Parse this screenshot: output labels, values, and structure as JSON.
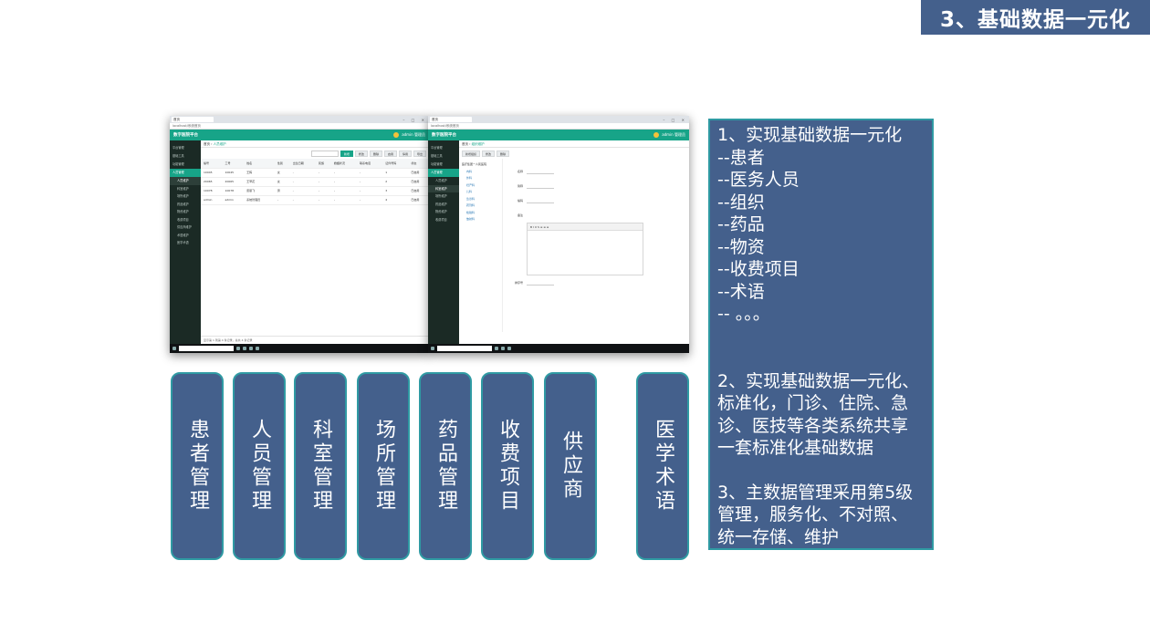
{
  "slide_title": "3、基础数据一元化",
  "screenshot_left": {
    "tab_label": "首页",
    "address": "localhost/系统首页",
    "app_logo": "数字医院平台",
    "user_name": "admin 管理员",
    "breadcrumb_home": "首页",
    "breadcrumb_current": "人员维护",
    "toolbar_buttons": [
      "新增",
      "修改",
      "删除",
      "启用",
      "停用",
      "导出"
    ],
    "sidebar_items": [
      "平台管理",
      "基础工具",
      "功能管理",
      "人员管理"
    ],
    "sidebar_subitems": [
      "人员维护",
      "科室维护",
      "场所维护",
      "药品维护",
      "物资维护",
      "收费项目",
      "供应商维护",
      "术语维护",
      "医学术语"
    ],
    "table_header": [
      "编号",
      "工号",
      "姓名",
      "性别",
      "出生日期",
      "民族",
      "婚姻状况",
      "联系电话",
      "证件号码",
      "状态"
    ],
    "table_rows": [
      [
        "1",
        "10045",
        "10045",
        "王辉",
        "女",
        "-",
        "-",
        "-",
        "-",
        "已启用"
      ],
      [
        "2",
        "20065",
        "20065",
        "王翠花",
        "女",
        "-",
        "-",
        "-",
        "-",
        "已启用"
      ],
      [
        "3",
        "10078",
        "10078",
        "唐丽飞",
        "男",
        "-",
        "-",
        "-",
        "-",
        "已启用"
      ],
      [
        "4",
        "admin",
        "admin",
        "系统管理员",
        "-",
        "-",
        "-",
        "-",
        "-",
        "已启用"
      ]
    ],
    "footer_text": "显示第 1 到第 4 条记录，总共 4 条记录"
  },
  "screenshot_right": {
    "tab_label": "首页",
    "address": "localhost/系统首页",
    "app_logo": "数字医院平台",
    "user_name": "admin 管理员",
    "breadcrumb_home": "首页",
    "breadcrumb_current": "组织维护",
    "toolbar_buttons": [
      "新增组织",
      "修改",
      "删除"
    ],
    "tree_root": "医疗集团一人民医院",
    "tree_nodes": [
      "内科",
      "外科",
      "妇产科",
      "儿科",
      "急诊科",
      "药剂科",
      "检验科",
      "放射科"
    ],
    "form_labels": [
      "名称",
      "简称",
      "编码",
      "备注",
      "排序号"
    ],
    "editor_toolbar": "B I U S ≡ ≡ ≡"
  },
  "categories": [
    "患者管理",
    "人员管理",
    "科室管理",
    "场所管理",
    "药品管理",
    "收费项目",
    "供应商",
    "医学术语"
  ],
  "panel": {
    "list_intro": "1、实现基础数据一元化",
    "list_items": [
      "--患者",
      "--医务人员",
      "--组织",
      "--药品",
      "--物资",
      "--收费项目",
      "--术语",
      "-- 。。。"
    ],
    "point2": "2、实现基础数据一元化、标准化，门诊、住院、急诊、医技等各类系统共享一套标准化基础数据",
    "point3": "3、主数据管理采用第5级管理，服务化、不对照、统一存储、维护"
  },
  "colors": {
    "title_bg": "#44608c",
    "box_bg": "#44608c",
    "box_border": "#2f9aa3",
    "app_green": "#17a488"
  }
}
